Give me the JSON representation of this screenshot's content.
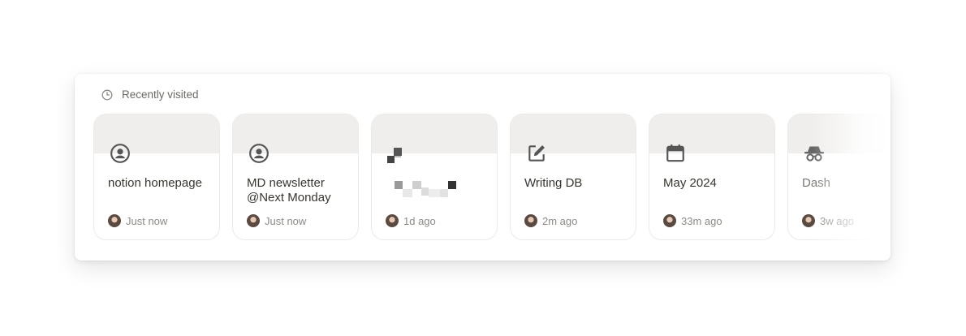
{
  "section": {
    "title": "Recently visited",
    "icon": "clock-icon"
  },
  "cards": [
    {
      "title": "notion homepage",
      "time": "Just now",
      "icon": "user-circle-icon"
    },
    {
      "title": "MD newsletter @Next Monday",
      "time": "Just now",
      "icon": "user-circle-icon"
    },
    {
      "title": "",
      "time": "1d ago",
      "icon": "pixelated-icon"
    },
    {
      "title": "Writing DB",
      "time": "2m ago",
      "icon": "edit-icon"
    },
    {
      "title": "May 2024",
      "time": "33m ago",
      "icon": "calendar-icon"
    },
    {
      "title": "Dash",
      "time": "3w ago",
      "icon": "incognito-icon"
    }
  ],
  "colors": {
    "text": "#37352f",
    "muted": "#8c8a85",
    "cover": "#efeeec",
    "icon": "#555555"
  }
}
